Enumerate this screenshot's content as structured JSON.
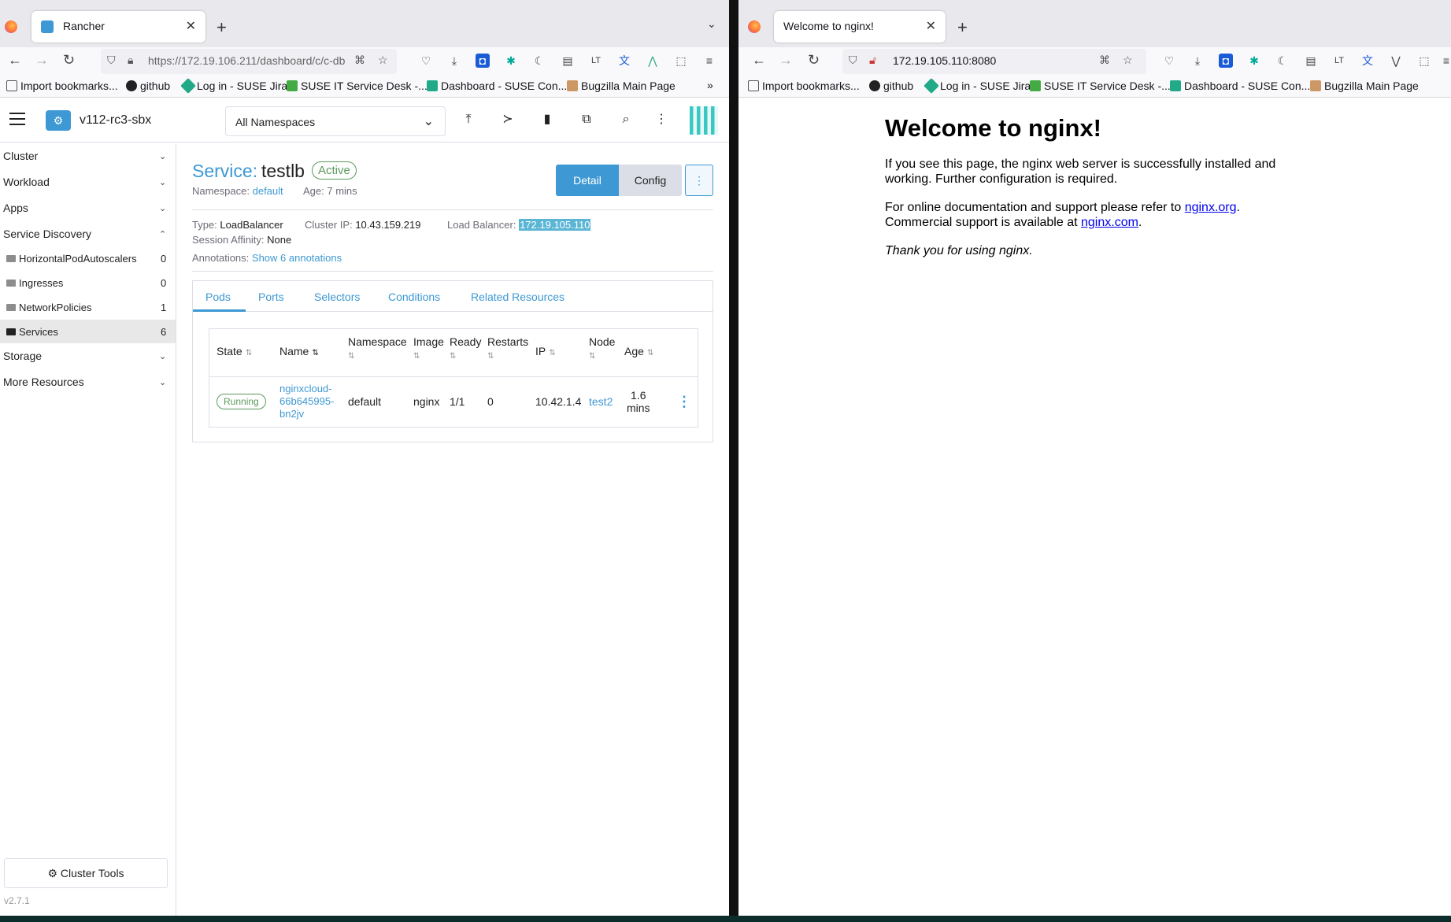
{
  "left_browser": {
    "tab_title": "Rancher",
    "url": "https://172.19.106.211/dashboard/c/c-db",
    "bookmarks": [
      "Import bookmarks...",
      "github",
      "Log in - SUSE Jira",
      "SUSE IT Service Desk -...",
      "Dashboard - SUSE Con...",
      "Bugzilla Main Page"
    ]
  },
  "right_browser": {
    "tab_title": "Welcome to nginx!",
    "url": "172.19.105.110:8080",
    "bookmarks": [
      "Import bookmarks...",
      "github",
      "Log in - SUSE Jira",
      "SUSE IT Service Desk -...",
      "Dashboard - SUSE Con...",
      "Bugzilla Main Page"
    ]
  },
  "rancher": {
    "cluster_name": "v112-rc3-sbx",
    "namespace_filter": "All Namespaces",
    "sidebar": {
      "groups": [
        "Cluster",
        "Workload",
        "Apps",
        "Service Discovery",
        "Storage",
        "More Resources"
      ],
      "items": [
        {
          "label": "HorizontalPodAutoscalers",
          "count": "0"
        },
        {
          "label": "Ingresses",
          "count": "0"
        },
        {
          "label": "NetworkPolicies",
          "count": "1"
        },
        {
          "label": "Services",
          "count": "6"
        }
      ],
      "cluster_tools": "Cluster Tools",
      "version": "v2.7.1"
    },
    "service": {
      "kind": "Service:",
      "name": "testlb",
      "state": "Active",
      "namespace_label": "Namespace:",
      "namespace": "default",
      "age_label": "Age:",
      "age": "7 mins",
      "type_label": "Type:",
      "type": "LoadBalancer",
      "cluster_ip_label": "Cluster IP:",
      "cluster_ip": "10.43.159.219",
      "lb_label": "Load Balancer:",
      "lb_ip": "172.19.105.110",
      "affinity_label": "Session Affinity:",
      "affinity": "None",
      "annotations_label": "Annotations:",
      "annotations_link": "Show 6 annotations"
    },
    "buttons": {
      "detail": "Detail",
      "config": "Config"
    },
    "tabs": [
      "Pods",
      "Ports",
      "Selectors",
      "Conditions",
      "Related Resources"
    ],
    "table": {
      "headers": [
        "State",
        "Name",
        "Namespace",
        "Image",
        "Ready",
        "Restarts",
        "IP",
        "Node",
        "Age"
      ],
      "row": {
        "state": "Running",
        "name_lines": [
          "nginxcloud-",
          "66b645995-",
          "bn2jv"
        ],
        "namespace": "default",
        "image": "nginx",
        "ready": "1/1",
        "restarts": "0",
        "ip": "10.42.1.4",
        "node": "test2",
        "age_lines": [
          "1.6",
          "mins"
        ]
      }
    }
  },
  "nginx": {
    "heading": "Welcome to nginx!",
    "p1": "If you see this page, the nginx web server is successfully installed and working. Further configuration is required.",
    "p2_pre": "For online documentation and support please refer to ",
    "p2_link1": "nginx.org",
    "p2_mid": ". Commercial support is available at ",
    "p2_link2": "nginx.com",
    "p2_post": ".",
    "p3": "Thank you for using nginx."
  }
}
